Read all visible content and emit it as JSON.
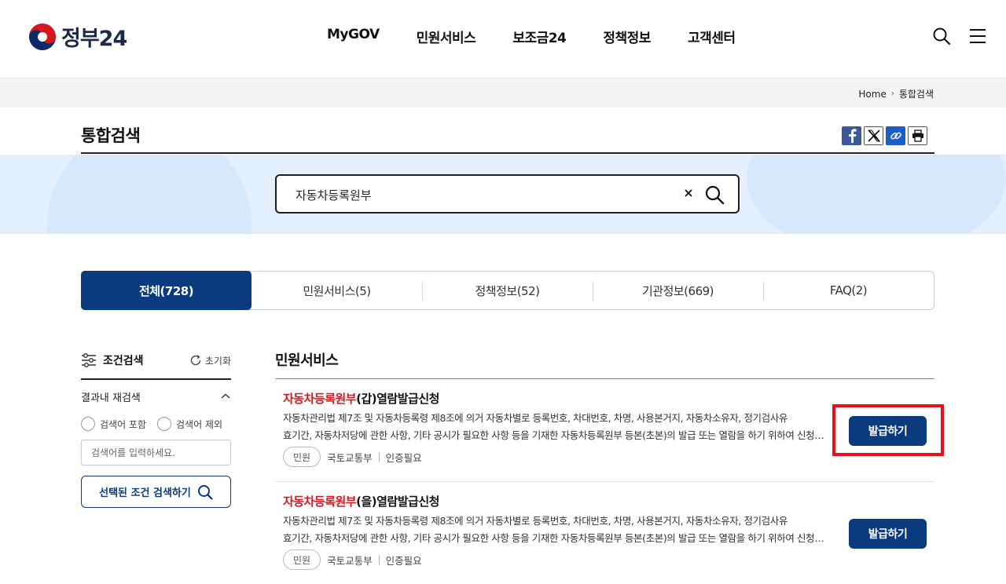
{
  "header": {
    "logo_text": "정부24",
    "nav": [
      "MyGOV",
      "민원서비스",
      "보조금24",
      "정책정보",
      "고객센터"
    ],
    "icons": [
      "search-icon",
      "menu-icon"
    ]
  },
  "breadcrumb": {
    "home": "Home",
    "current": "통합검색"
  },
  "page": {
    "title": "통합검색"
  },
  "share": [
    "facebook-icon",
    "x-icon",
    "link-icon",
    "print-icon"
  ],
  "search": {
    "query": "자동차등록원부"
  },
  "tabs": [
    {
      "label": "전체(728)",
      "active": true
    },
    {
      "label": "민원서비스(5)",
      "active": false
    },
    {
      "label": "정책정보(52)",
      "active": false
    },
    {
      "label": "기관정보(669)",
      "active": false
    },
    {
      "label": "FAQ(2)",
      "active": false
    }
  ],
  "filter": {
    "title": "조건검색",
    "reset": "초기화",
    "refine_title": "결과내 재검색",
    "include": "검색어 포함",
    "exclude": "검색어 제외",
    "placeholder": "검색어를 입력하세요.",
    "submit": "선택된 조건 검색하기"
  },
  "section": {
    "title": "민원서비스"
  },
  "results": [
    {
      "title_highlight": "자동차등록원부",
      "title_rest": "(갑)열람발급신청",
      "desc_line1": "자동차관리법 제7조 및 자동차등록령 제8조에 의거 자동차별로 등록번호, 차대번호, 차명, 사용본거지, 자동차소유자, 정기검사유",
      "desc_line2": "효기간, 자동차저당에 관한 사항, 기타 공시가 필요한 사항 등을 기재한 자동차등록원부 등본(초본)의 발급 또는 열람을 하기 위하여 신청하는 민원",
      "badge": "민원",
      "agency": "국토교통부",
      "auth": "인증필요",
      "button": "발급하기"
    },
    {
      "title_highlight": "자동차등록원부",
      "title_rest": "(을)열람발급신청",
      "desc_line1": "자동차관리법 제7조 및 자동차등록령 제8조에 의거 자동차별로 등록번호, 차대번호, 차명, 사용본거지, 자동차소유자, 정기검사유",
      "desc_line2": "효기간, 자동차저당에 관한 사항, 기타 공시가 필요한 사항 등을 기재한 자동차등록원부 등본(초본)의 발급 또는 열람을 하기 위하여 신청하는 민원",
      "badge": "민원",
      "agency": "국토교통부",
      "auth": "인증필요",
      "button": "발급하기"
    }
  ],
  "colors": {
    "primary": "#0b3a7e",
    "highlight_text": "#d5171e",
    "annotation_box": "#e5141b",
    "search_band": "#e4efff"
  }
}
